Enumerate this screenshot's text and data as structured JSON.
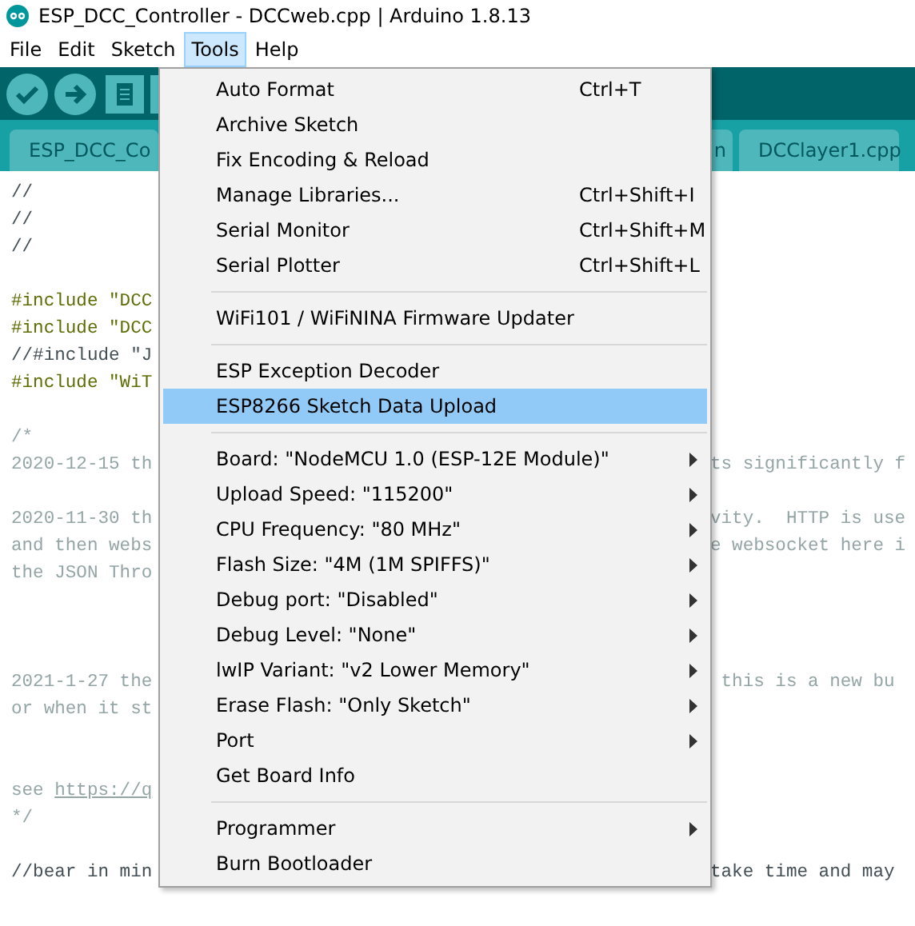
{
  "window": {
    "title": "ESP_DCC_Controller - DCCweb.cpp | Arduino 1.8.13"
  },
  "menubar": [
    {
      "label": "File",
      "selected": false
    },
    {
      "label": "Edit",
      "selected": false
    },
    {
      "label": "Sketch",
      "selected": false
    },
    {
      "label": "Tools",
      "selected": true
    },
    {
      "label": "Help",
      "selected": false
    }
  ],
  "tabs": [
    {
      "label": "ESP_DCC_Co"
    },
    {
      "label": "n"
    },
    {
      "label": "DCClayer1.cpp"
    }
  ],
  "code_lines": [
    {
      "kind": "comment",
      "left": "//"
    },
    {
      "kind": "comment",
      "left": "//"
    },
    {
      "kind": "comment",
      "left": "//"
    },
    {
      "kind": "blank"
    },
    {
      "kind": "include",
      "left": "#include \"DCC"
    },
    {
      "kind": "include",
      "left": "#include \"DCC"
    },
    {
      "kind": "comment",
      "left": "//#include \"J"
    },
    {
      "kind": "include",
      "left": "#include \"WiT"
    },
    {
      "kind": "blank"
    },
    {
      "kind": "block",
      "left": "/*"
    },
    {
      "kind": "block",
      "left": "2020-12-15 th",
      "right": "ts significantly f"
    },
    {
      "kind": "blank"
    },
    {
      "kind": "block",
      "left": "2020-11-30 th",
      "right": "vity.  HTTP is use"
    },
    {
      "kind": "block",
      "left": "and then webs",
      "right": "e websocket here i"
    },
    {
      "kind": "block",
      "left": "the JSON Thro"
    },
    {
      "kind": "blank"
    },
    {
      "kind": "blank"
    },
    {
      "kind": "blank"
    },
    {
      "kind": "block",
      "left": "2021-1-27 the",
      "right": " this is a new bu"
    },
    {
      "kind": "block",
      "left": "or when it st"
    },
    {
      "kind": "blank"
    },
    {
      "kind": "blank"
    },
    {
      "kind": "link",
      "left": "see ",
      "link": "https://q"
    },
    {
      "kind": "block",
      "left": "*/"
    },
    {
      "kind": "blank"
    },
    {
      "kind": "comment",
      "left": "//bear in min",
      "right": "take time and may"
    }
  ],
  "tools_menu": [
    {
      "kind": "item",
      "label": "Auto Format",
      "shortcut": "Ctrl+T",
      "selected": false
    },
    {
      "kind": "item",
      "label": "Archive Sketch",
      "selected": false
    },
    {
      "kind": "item",
      "label": "Fix Encoding & Reload",
      "selected": false
    },
    {
      "kind": "item",
      "label": "Manage Libraries...",
      "shortcut": "Ctrl+Shift+I",
      "selected": false
    },
    {
      "kind": "item",
      "label": "Serial Monitor",
      "shortcut": "Ctrl+Shift+M",
      "selected": false
    },
    {
      "kind": "item",
      "label": "Serial Plotter",
      "shortcut": "Ctrl+Shift+L",
      "selected": false
    },
    {
      "kind": "separator"
    },
    {
      "kind": "item",
      "label": "WiFi101 / WiFiNINA Firmware Updater",
      "selected": false
    },
    {
      "kind": "separator"
    },
    {
      "kind": "item",
      "label": "ESP Exception Decoder",
      "selected": false
    },
    {
      "kind": "item",
      "label": "ESP8266 Sketch Data Upload",
      "selected": true
    },
    {
      "kind": "separator"
    },
    {
      "kind": "submenu",
      "label": "Board: \"NodeMCU 1.0 (ESP-12E Module)\"",
      "selected": false
    },
    {
      "kind": "submenu",
      "label": "Upload Speed: \"115200\"",
      "selected": false
    },
    {
      "kind": "submenu",
      "label": "CPU Frequency: \"80 MHz\"",
      "selected": false
    },
    {
      "kind": "submenu",
      "label": "Flash Size: \"4M (1M SPIFFS)\"",
      "selected": false
    },
    {
      "kind": "submenu",
      "label": "Debug port: \"Disabled\"",
      "selected": false
    },
    {
      "kind": "submenu",
      "label": "Debug Level: \"None\"",
      "selected": false
    },
    {
      "kind": "submenu",
      "label": "lwIP Variant: \"v2 Lower Memory\"",
      "selected": false
    },
    {
      "kind": "submenu",
      "label": "Erase Flash: \"Only Sketch\"",
      "selected": false
    },
    {
      "kind": "submenu",
      "label": "Port",
      "selected": false
    },
    {
      "kind": "item",
      "label": "Get Board Info",
      "selected": false
    },
    {
      "kind": "separator"
    },
    {
      "kind": "submenu",
      "label": "Programmer",
      "selected": false
    },
    {
      "kind": "item",
      "label": "Burn Bootloader",
      "selected": false
    }
  ]
}
